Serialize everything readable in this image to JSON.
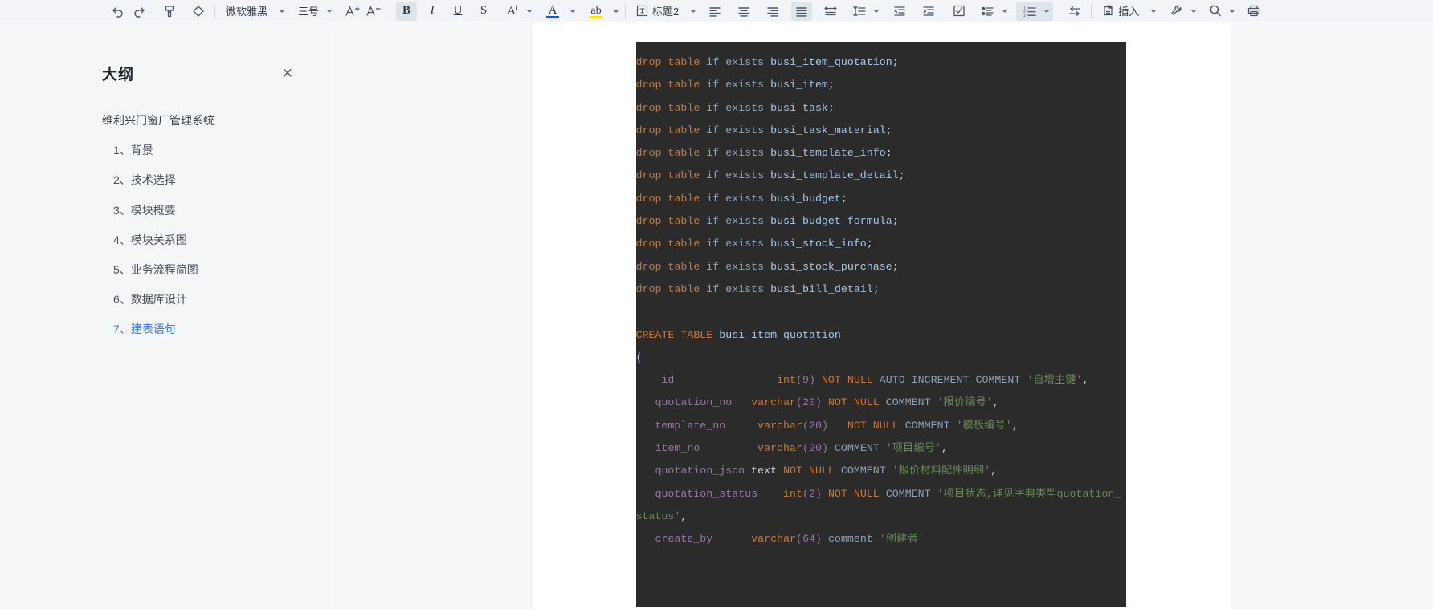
{
  "toolbar": {
    "undo": {
      "name": "undo",
      "label": "↶"
    },
    "redo": {
      "name": "redo",
      "label": "↷"
    },
    "format_painter": {
      "name": "format-painter",
      "label": ""
    },
    "clear_format": {
      "name": "clear-format",
      "label": ""
    },
    "font_family": "微软雅黑",
    "font_size": "三号",
    "increase_font": "A+",
    "decrease_font": "A-",
    "bold": "B",
    "italic": "I",
    "underline": "U",
    "strikethrough": "S",
    "text_effects": "Aⁱ",
    "font_color": "A",
    "font_color_hex": "#1a56db",
    "highlight": "ab",
    "highlight_hex": "#fbe400",
    "style_name": "标题2",
    "align_left": "align-left",
    "align_center": "align-center",
    "align_right": "align-right",
    "align_justify": "align-justify",
    "distribute": "distribute",
    "line_spacing": "line-spacing",
    "decrease_indent": "decrease-indent",
    "increase_indent": "increase-indent",
    "checklist": "checklist",
    "bullet_list": "bullet-list",
    "numbered_list": "numbered-list",
    "text_direction": "text-direction",
    "insert_label": "插入",
    "tools": "tools",
    "find": "find",
    "print": "print",
    "active_buttons": [
      "bold",
      "align_justify",
      "numbered_list"
    ]
  },
  "outline": {
    "title": "大纲",
    "close_label": "✕",
    "root": "维利兴门窗厂管理系统",
    "items": [
      {
        "label": "1、背景",
        "active": false
      },
      {
        "label": "2、技术选择",
        "active": false
      },
      {
        "label": "3、模块概要",
        "active": false
      },
      {
        "label": "4、模块关系图",
        "active": false
      },
      {
        "label": "5、业务流程简图",
        "active": false
      },
      {
        "label": "6、数据库设计",
        "active": false
      },
      {
        "label": "7、建表语句",
        "active": true
      }
    ],
    "active_color": "#3a7af0"
  },
  "document": {
    "code_block": {
      "background": "#2b2b2b",
      "language": "sql",
      "colors": {
        "keyword": "#cc7832",
        "secondary_keyword": "#8fa2b8",
        "identifier": "#a9c7e8",
        "column": "#9876aa",
        "string": "#6a8759",
        "number": "#9876aa"
      },
      "lines": [
        [
          {
            "t": "drop table",
            "c": "k-orange"
          },
          {
            "t": " ",
            "c": "k-plain"
          },
          {
            "t": "if exists",
            "c": "k-blue"
          },
          {
            "t": " ",
            "c": "k-plain"
          },
          {
            "t": "busi_item_quotation",
            "c": "k-ident"
          },
          {
            "t": ";",
            "c": "k-plain"
          }
        ],
        [
          {
            "t": "drop table",
            "c": "k-orange"
          },
          {
            "t": " ",
            "c": "k-plain"
          },
          {
            "t": "if exists",
            "c": "k-blue"
          },
          {
            "t": " ",
            "c": "k-plain"
          },
          {
            "t": "busi_item",
            "c": "k-ident"
          },
          {
            "t": ";",
            "c": "k-plain"
          }
        ],
        [
          {
            "t": "drop table",
            "c": "k-orange"
          },
          {
            "t": " ",
            "c": "k-plain"
          },
          {
            "t": "if exists",
            "c": "k-blue"
          },
          {
            "t": " ",
            "c": "k-plain"
          },
          {
            "t": "busi_task",
            "c": "k-ident"
          },
          {
            "t": ";",
            "c": "k-plain"
          }
        ],
        [
          {
            "t": "drop table",
            "c": "k-orange"
          },
          {
            "t": " ",
            "c": "k-plain"
          },
          {
            "t": "if exists",
            "c": "k-blue"
          },
          {
            "t": " ",
            "c": "k-plain"
          },
          {
            "t": "busi_task_material",
            "c": "k-ident"
          },
          {
            "t": ";",
            "c": "k-plain"
          }
        ],
        [
          {
            "t": "drop table",
            "c": "k-orange"
          },
          {
            "t": " ",
            "c": "k-plain"
          },
          {
            "t": "if exists",
            "c": "k-blue"
          },
          {
            "t": " ",
            "c": "k-plain"
          },
          {
            "t": "busi_template_info",
            "c": "k-ident"
          },
          {
            "t": ";",
            "c": "k-plain"
          }
        ],
        [
          {
            "t": "drop table",
            "c": "k-orange"
          },
          {
            "t": " ",
            "c": "k-plain"
          },
          {
            "t": "if exists",
            "c": "k-blue"
          },
          {
            "t": " ",
            "c": "k-plain"
          },
          {
            "t": "busi_template_detail",
            "c": "k-ident"
          },
          {
            "t": ";",
            "c": "k-plain"
          }
        ],
        [
          {
            "t": "drop table",
            "c": "k-orange"
          },
          {
            "t": " ",
            "c": "k-plain"
          },
          {
            "t": "if exists",
            "c": "k-blue"
          },
          {
            "t": " ",
            "c": "k-plain"
          },
          {
            "t": "busi_budget",
            "c": "k-ident"
          },
          {
            "t": ";",
            "c": "k-plain"
          }
        ],
        [
          {
            "t": "drop table",
            "c": "k-orange"
          },
          {
            "t": " ",
            "c": "k-plain"
          },
          {
            "t": "if exists",
            "c": "k-blue"
          },
          {
            "t": " ",
            "c": "k-plain"
          },
          {
            "t": "busi_budget_formula",
            "c": "k-ident"
          },
          {
            "t": ";",
            "c": "k-plain"
          }
        ],
        [
          {
            "t": "drop table",
            "c": "k-orange"
          },
          {
            "t": " ",
            "c": "k-plain"
          },
          {
            "t": "if exists",
            "c": "k-blue"
          },
          {
            "t": " ",
            "c": "k-plain"
          },
          {
            "t": "busi_stock_info",
            "c": "k-ident"
          },
          {
            "t": ";",
            "c": "k-plain"
          }
        ],
        [
          {
            "t": "drop table",
            "c": "k-orange"
          },
          {
            "t": " ",
            "c": "k-plain"
          },
          {
            "t": "if exists",
            "c": "k-blue"
          },
          {
            "t": " ",
            "c": "k-plain"
          },
          {
            "t": "busi_stock_purchase",
            "c": "k-ident"
          },
          {
            "t": ";",
            "c": "k-plain"
          }
        ],
        [
          {
            "t": "drop table",
            "c": "k-orange"
          },
          {
            "t": " ",
            "c": "k-plain"
          },
          {
            "t": "if exists",
            "c": "k-blue"
          },
          {
            "t": " ",
            "c": "k-plain"
          },
          {
            "t": "busi_bill_detail",
            "c": "k-ident"
          },
          {
            "t": ";",
            "c": "k-plain"
          }
        ],
        [],
        [
          {
            "t": "CREATE TABLE",
            "c": "k-orange"
          },
          {
            "t": " ",
            "c": "k-plain"
          },
          {
            "t": "busi_item_quotation",
            "c": "k-ident"
          }
        ],
        [
          {
            "t": "(",
            "c": "k-ident"
          }
        ],
        [
          {
            "t": "    id",
            "c": "k-col"
          },
          {
            "t": "                ",
            "c": "k-plain"
          },
          {
            "t": "int",
            "c": "k-orange"
          },
          {
            "t": "(9)",
            "c": "k-num"
          },
          {
            "t": " ",
            "c": "k-plain"
          },
          {
            "t": "NOT NULL",
            "c": "k-orange"
          },
          {
            "t": " ",
            "c": "k-plain"
          },
          {
            "t": "AUTO_INCREMENT",
            "c": "k-blue"
          },
          {
            "t": " ",
            "c": "k-plain"
          },
          {
            "t": "COMMENT",
            "c": "k-blue"
          },
          {
            "t": " ",
            "c": "k-plain"
          },
          {
            "t": "'自增主键'",
            "c": "k-str"
          },
          {
            "t": ",",
            "c": "k-plain"
          }
        ],
        [
          {
            "t": "   quotation_no",
            "c": "k-col"
          },
          {
            "t": "   ",
            "c": "k-plain"
          },
          {
            "t": "varchar",
            "c": "k-orange"
          },
          {
            "t": "(20)",
            "c": "k-num"
          },
          {
            "t": " ",
            "c": "k-plain"
          },
          {
            "t": "NOT NULL",
            "c": "k-orange"
          },
          {
            "t": " ",
            "c": "k-plain"
          },
          {
            "t": "COMMENT",
            "c": "k-blue"
          },
          {
            "t": " ",
            "c": "k-plain"
          },
          {
            "t": "'报价编号'",
            "c": "k-str"
          },
          {
            "t": ",",
            "c": "k-plain"
          }
        ],
        [
          {
            "t": "   template_no",
            "c": "k-col"
          },
          {
            "t": "     ",
            "c": "k-plain"
          },
          {
            "t": "varchar",
            "c": "k-orange"
          },
          {
            "t": "(20)",
            "c": "k-num"
          },
          {
            "t": "   ",
            "c": "k-plain"
          },
          {
            "t": "NOT NULL",
            "c": "k-orange"
          },
          {
            "t": " ",
            "c": "k-plain"
          },
          {
            "t": "COMMENT",
            "c": "k-blue"
          },
          {
            "t": " ",
            "c": "k-plain"
          },
          {
            "t": "'模板编号'",
            "c": "k-str"
          },
          {
            "t": ",",
            "c": "k-plain"
          }
        ],
        [
          {
            "t": "   item_no",
            "c": "k-col"
          },
          {
            "t": "         ",
            "c": "k-plain"
          },
          {
            "t": "varchar",
            "c": "k-orange"
          },
          {
            "t": "(20)",
            "c": "k-num"
          },
          {
            "t": " ",
            "c": "k-plain"
          },
          {
            "t": "COMMENT",
            "c": "k-blue"
          },
          {
            "t": " ",
            "c": "k-plain"
          },
          {
            "t": "'项目编号'",
            "c": "k-str"
          },
          {
            "t": ",",
            "c": "k-plain"
          }
        ],
        [
          {
            "t": "   quotation_json",
            "c": "k-col"
          },
          {
            "t": " ",
            "c": "k-plain"
          },
          {
            "t": "text",
            "c": "k-plain"
          },
          {
            "t": " ",
            "c": "k-plain"
          },
          {
            "t": "NOT NULL",
            "c": "k-orange"
          },
          {
            "t": " ",
            "c": "k-plain"
          },
          {
            "t": "COMMENT",
            "c": "k-blue"
          },
          {
            "t": " ",
            "c": "k-plain"
          },
          {
            "t": "'报价材料配件明细'",
            "c": "k-str"
          },
          {
            "t": ",",
            "c": "k-plain"
          }
        ],
        [
          {
            "t": "   quotation_status",
            "c": "k-col"
          },
          {
            "t": "    ",
            "c": "k-plain"
          },
          {
            "t": "int",
            "c": "k-orange"
          },
          {
            "t": "(2)",
            "c": "k-num"
          },
          {
            "t": " ",
            "c": "k-plain"
          },
          {
            "t": "NOT NULL",
            "c": "k-orange"
          },
          {
            "t": " ",
            "c": "k-plain"
          },
          {
            "t": "COMMENT",
            "c": "k-blue"
          },
          {
            "t": " ",
            "c": "k-plain"
          },
          {
            "t": "'项目状态,详见字典类型quotation_status'",
            "c": "k-str"
          },
          {
            "t": ",",
            "c": "k-plain"
          }
        ],
        [
          {
            "t": "   create_by",
            "c": "k-col"
          },
          {
            "t": "      ",
            "c": "k-plain"
          },
          {
            "t": "varchar",
            "c": "k-orange"
          },
          {
            "t": "(64)",
            "c": "k-num"
          },
          {
            "t": " ",
            "c": "k-plain"
          },
          {
            "t": "comment",
            "c": "k-blue"
          },
          {
            "t": " ",
            "c": "k-plain"
          },
          {
            "t": "'创建者'",
            "c": "k-str"
          }
        ]
      ]
    }
  }
}
